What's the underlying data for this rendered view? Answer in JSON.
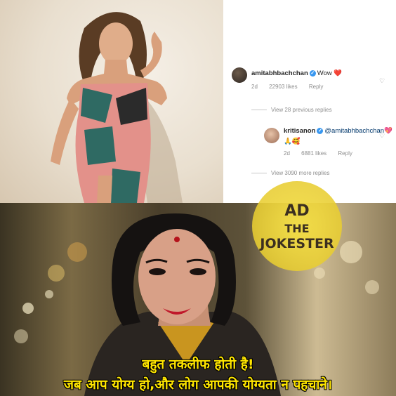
{
  "comments": {
    "first": {
      "username": "amitabhbachchan",
      "verified_icon": "verified-badge-icon",
      "text": "Wow ❤️",
      "time": "2d",
      "likes": "22903 likes",
      "reply": "Reply"
    },
    "view_previous": "View 28 previous replies",
    "second": {
      "username": "kritisanon",
      "verified_icon": "verified-badge-icon",
      "mention": "@amitabhbachchan",
      "emoji_line1": "💖",
      "emoji_line2": "🙏🥰",
      "time": "2d",
      "likes": "6881 likes",
      "reply": "Reply"
    },
    "view_more": "View 3090 more replies"
  },
  "logo": {
    "line1": "AD",
    "line2": "THE",
    "line3": "JOKESTER"
  },
  "caption": {
    "line1": "बहुत तकलीफ होती है!",
    "line2": "जब आप योग्य हो,और लोग आपकी योग्यता न पहचाने।"
  },
  "colors": {
    "caption": "#ffe600",
    "logo": "#f2d93a",
    "verified": "#3897f0"
  }
}
